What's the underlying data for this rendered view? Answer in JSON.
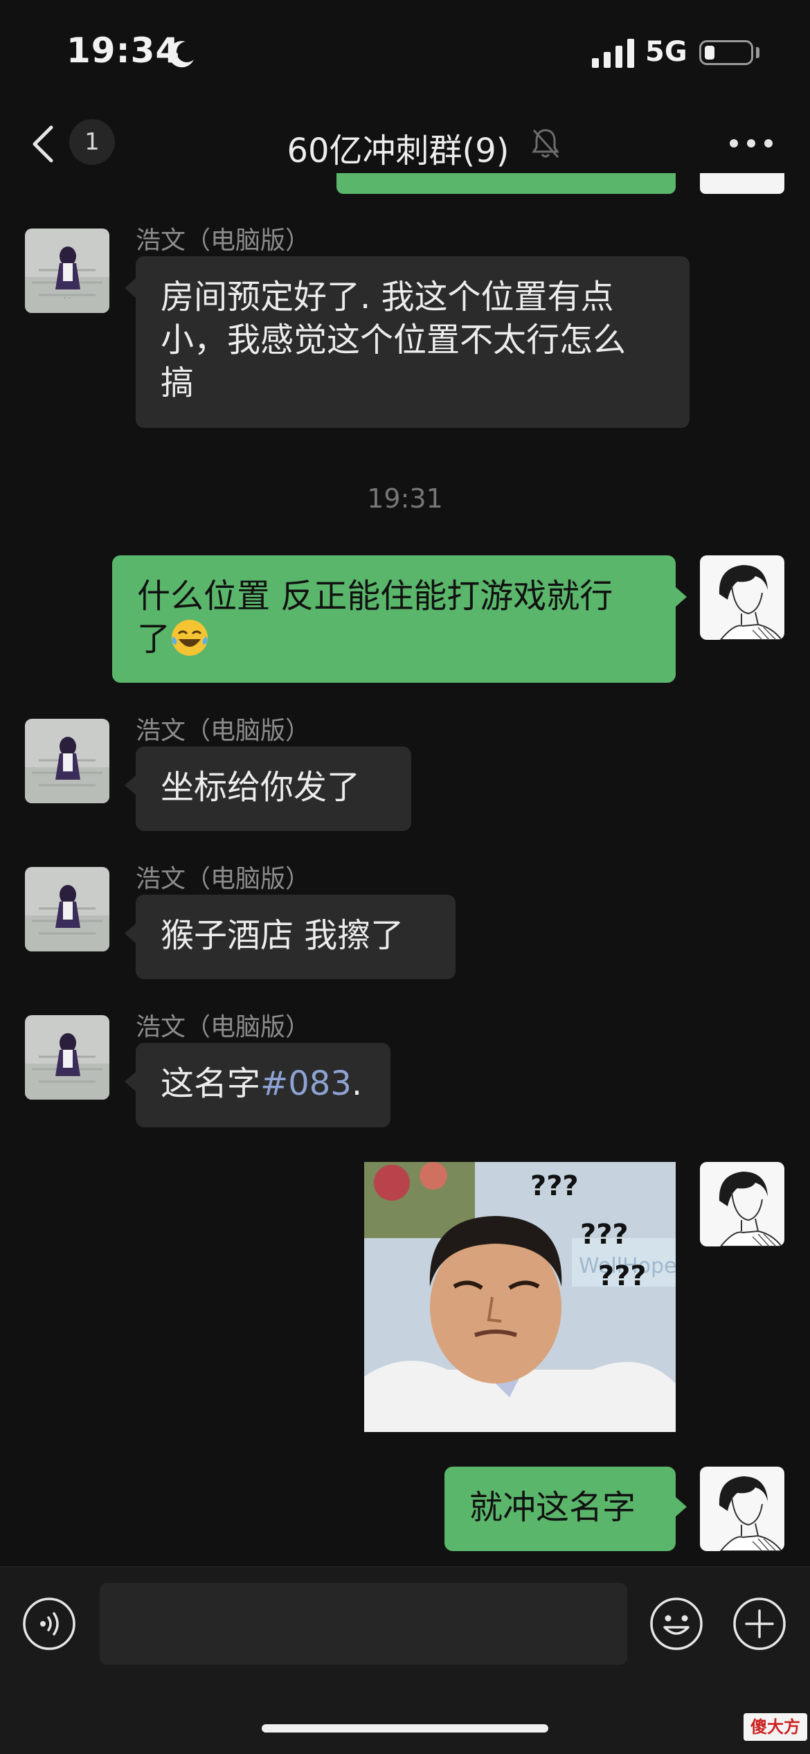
{
  "status_bar": {
    "time": "19:34",
    "network": "5G"
  },
  "nav": {
    "unread_count": "1",
    "title": "60亿冲刺群(9)"
  },
  "messages": [
    {
      "sender": "浩文（电脑版）",
      "lines": [
        "房间预定好了. 我这个位置有点",
        "小，我感觉这个位置不太行怎么",
        "搞"
      ]
    },
    {
      "timestamp": "19:31"
    },
    {
      "lines": [
        "什么位置 反正能住能打游戏就行",
        "了"
      ]
    },
    {
      "sender": "浩文（电脑版）",
      "text": "坐标给你发了"
    },
    {
      "sender": "浩文（电脑版）",
      "text": "猴子酒店 我擦了"
    },
    {
      "sender": "浩文（电脑版）",
      "text": "这名字",
      "tag": "#083",
      "tail": "."
    },
    {
      "image": {
        "question_marks": [
          "???",
          "???",
          "???"
        ],
        "sign_text": "WellHope Medi"
      }
    },
    {
      "text": "就冲这名字"
    }
  ],
  "watermark": "傻大方",
  "colors": {
    "background": "#111111",
    "bubble_in": "#2b2b2b",
    "bubble_out": "#5ab66a",
    "link": "#8ea3d4"
  }
}
